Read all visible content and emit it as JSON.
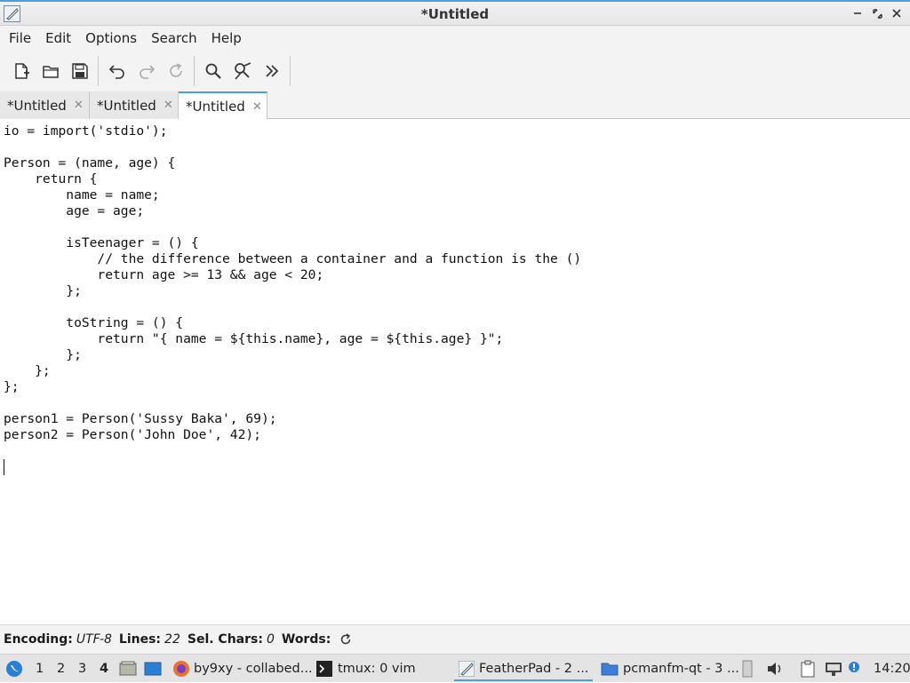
{
  "window": {
    "title": "*Untitled"
  },
  "menu": [
    "File",
    "Edit",
    "Options",
    "Search",
    "Help"
  ],
  "toolbar": {
    "icons": [
      "new-document-icon",
      "open-folder-icon",
      "save-icon",
      "undo-icon",
      "redo-icon",
      "reload-icon",
      "search-icon",
      "replace-icon",
      "more-icon"
    ]
  },
  "tabs": [
    {
      "label": "*Untitled",
      "active": false
    },
    {
      "label": "*Untitled",
      "active": false
    },
    {
      "label": "*Untitled",
      "active": true
    }
  ],
  "code": [
    "io = import('stdio');",
    "",
    "Person = (name, age) {",
    "    return {",
    "        name = name;",
    "        age = age;",
    "",
    "        isTeenager = () {",
    "            // the difference between a container and a function is the ()",
    "            return age >= 13 && age < 20;",
    "        };",
    "",
    "        toString = () {",
    "            return \"{ name = ${this.name}, age = ${this.age} }\";",
    "        };",
    "    };",
    "};",
    "",
    "person1 = Person('Sussy Baka', 69);",
    "person2 = Person('John Doe', 42);"
  ],
  "status": {
    "encoding_label": "Encoding:",
    "encoding_value": "UTF-8",
    "lines_label": "Lines:",
    "lines_value": "22",
    "sel_label": "Sel. Chars:",
    "sel_value": "0",
    "words_label": "Words:"
  },
  "taskbar": {
    "workspaces": [
      "1",
      "2",
      "3",
      "4"
    ],
    "active_workspace": "4",
    "tasks": [
      {
        "label": "by9xy - collabed...",
        "icon": "firefox-icon"
      },
      {
        "label": "tmux: 0 vim",
        "icon": "terminal-icon"
      },
      {
        "label": "FeatherPad - 2 ...",
        "icon": "featherpad-icon",
        "active": true
      },
      {
        "label": "pcmanfm-qt - 3 ...",
        "icon": "folder-icon"
      }
    ],
    "clock": "14:20"
  },
  "colors": {
    "accent": "#4a9fe0",
    "chrome": "#f3f3f3",
    "editor_bg": "#ffffff"
  }
}
